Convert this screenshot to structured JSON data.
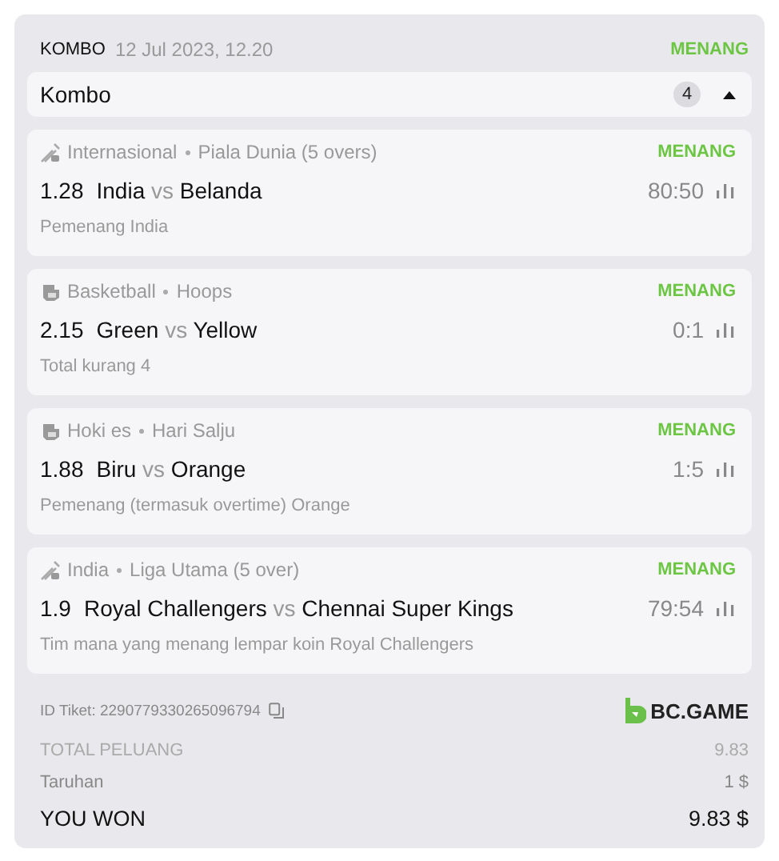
{
  "header": {
    "type": "KOMBO",
    "date": "12 Jul 2023, 12.20",
    "status": "MENANG"
  },
  "group": {
    "title": "Kombo",
    "count": "4",
    "expanded": true
  },
  "bets": [
    {
      "kind": "cricket",
      "category": "Internasional",
      "league": "Piala Dunia (5 overs)",
      "status": "MENANG",
      "odds": "1.28",
      "home": "India",
      "vs": "vs",
      "away": "Belanda",
      "score": "80:50",
      "market": "Pemenang India"
    },
    {
      "kind": "arena",
      "category": "Basketball",
      "league": "Hoops",
      "status": "MENANG",
      "odds": "2.15",
      "home": "Green",
      "vs": "vs",
      "away": "Yellow",
      "score": "0:1",
      "market": "Total kurang 4"
    },
    {
      "kind": "arena",
      "category": "Hoki es",
      "league": "Hari Salju",
      "status": "MENANG",
      "odds": "1.88",
      "home": "Biru",
      "vs": "vs",
      "away": "Orange",
      "score": "1:5",
      "market": "Pemenang (termasuk overtime) Orange"
    },
    {
      "kind": "cricket",
      "category": "India",
      "league": "Liga Utama (5 over)",
      "status": "MENANG",
      "odds": "1.9",
      "home": "Royal Challengers",
      "vs": "vs",
      "away": "Chennai Super Kings",
      "score": "79:54",
      "market": "Tim mana yang menang lempar koin Royal Challengers"
    }
  ],
  "ticket": {
    "id": "ID Tiket: 2290779330265096794",
    "brand": "BC.GAME"
  },
  "totals": [
    {
      "kind": "muted",
      "label": "TOTAL PELUANG",
      "value": "9.83"
    },
    {
      "kind": "normal",
      "label": "Taruhan",
      "value": "1 $"
    },
    {
      "kind": "strong",
      "label": "YOU WON",
      "value": "9.83 $"
    }
  ]
}
